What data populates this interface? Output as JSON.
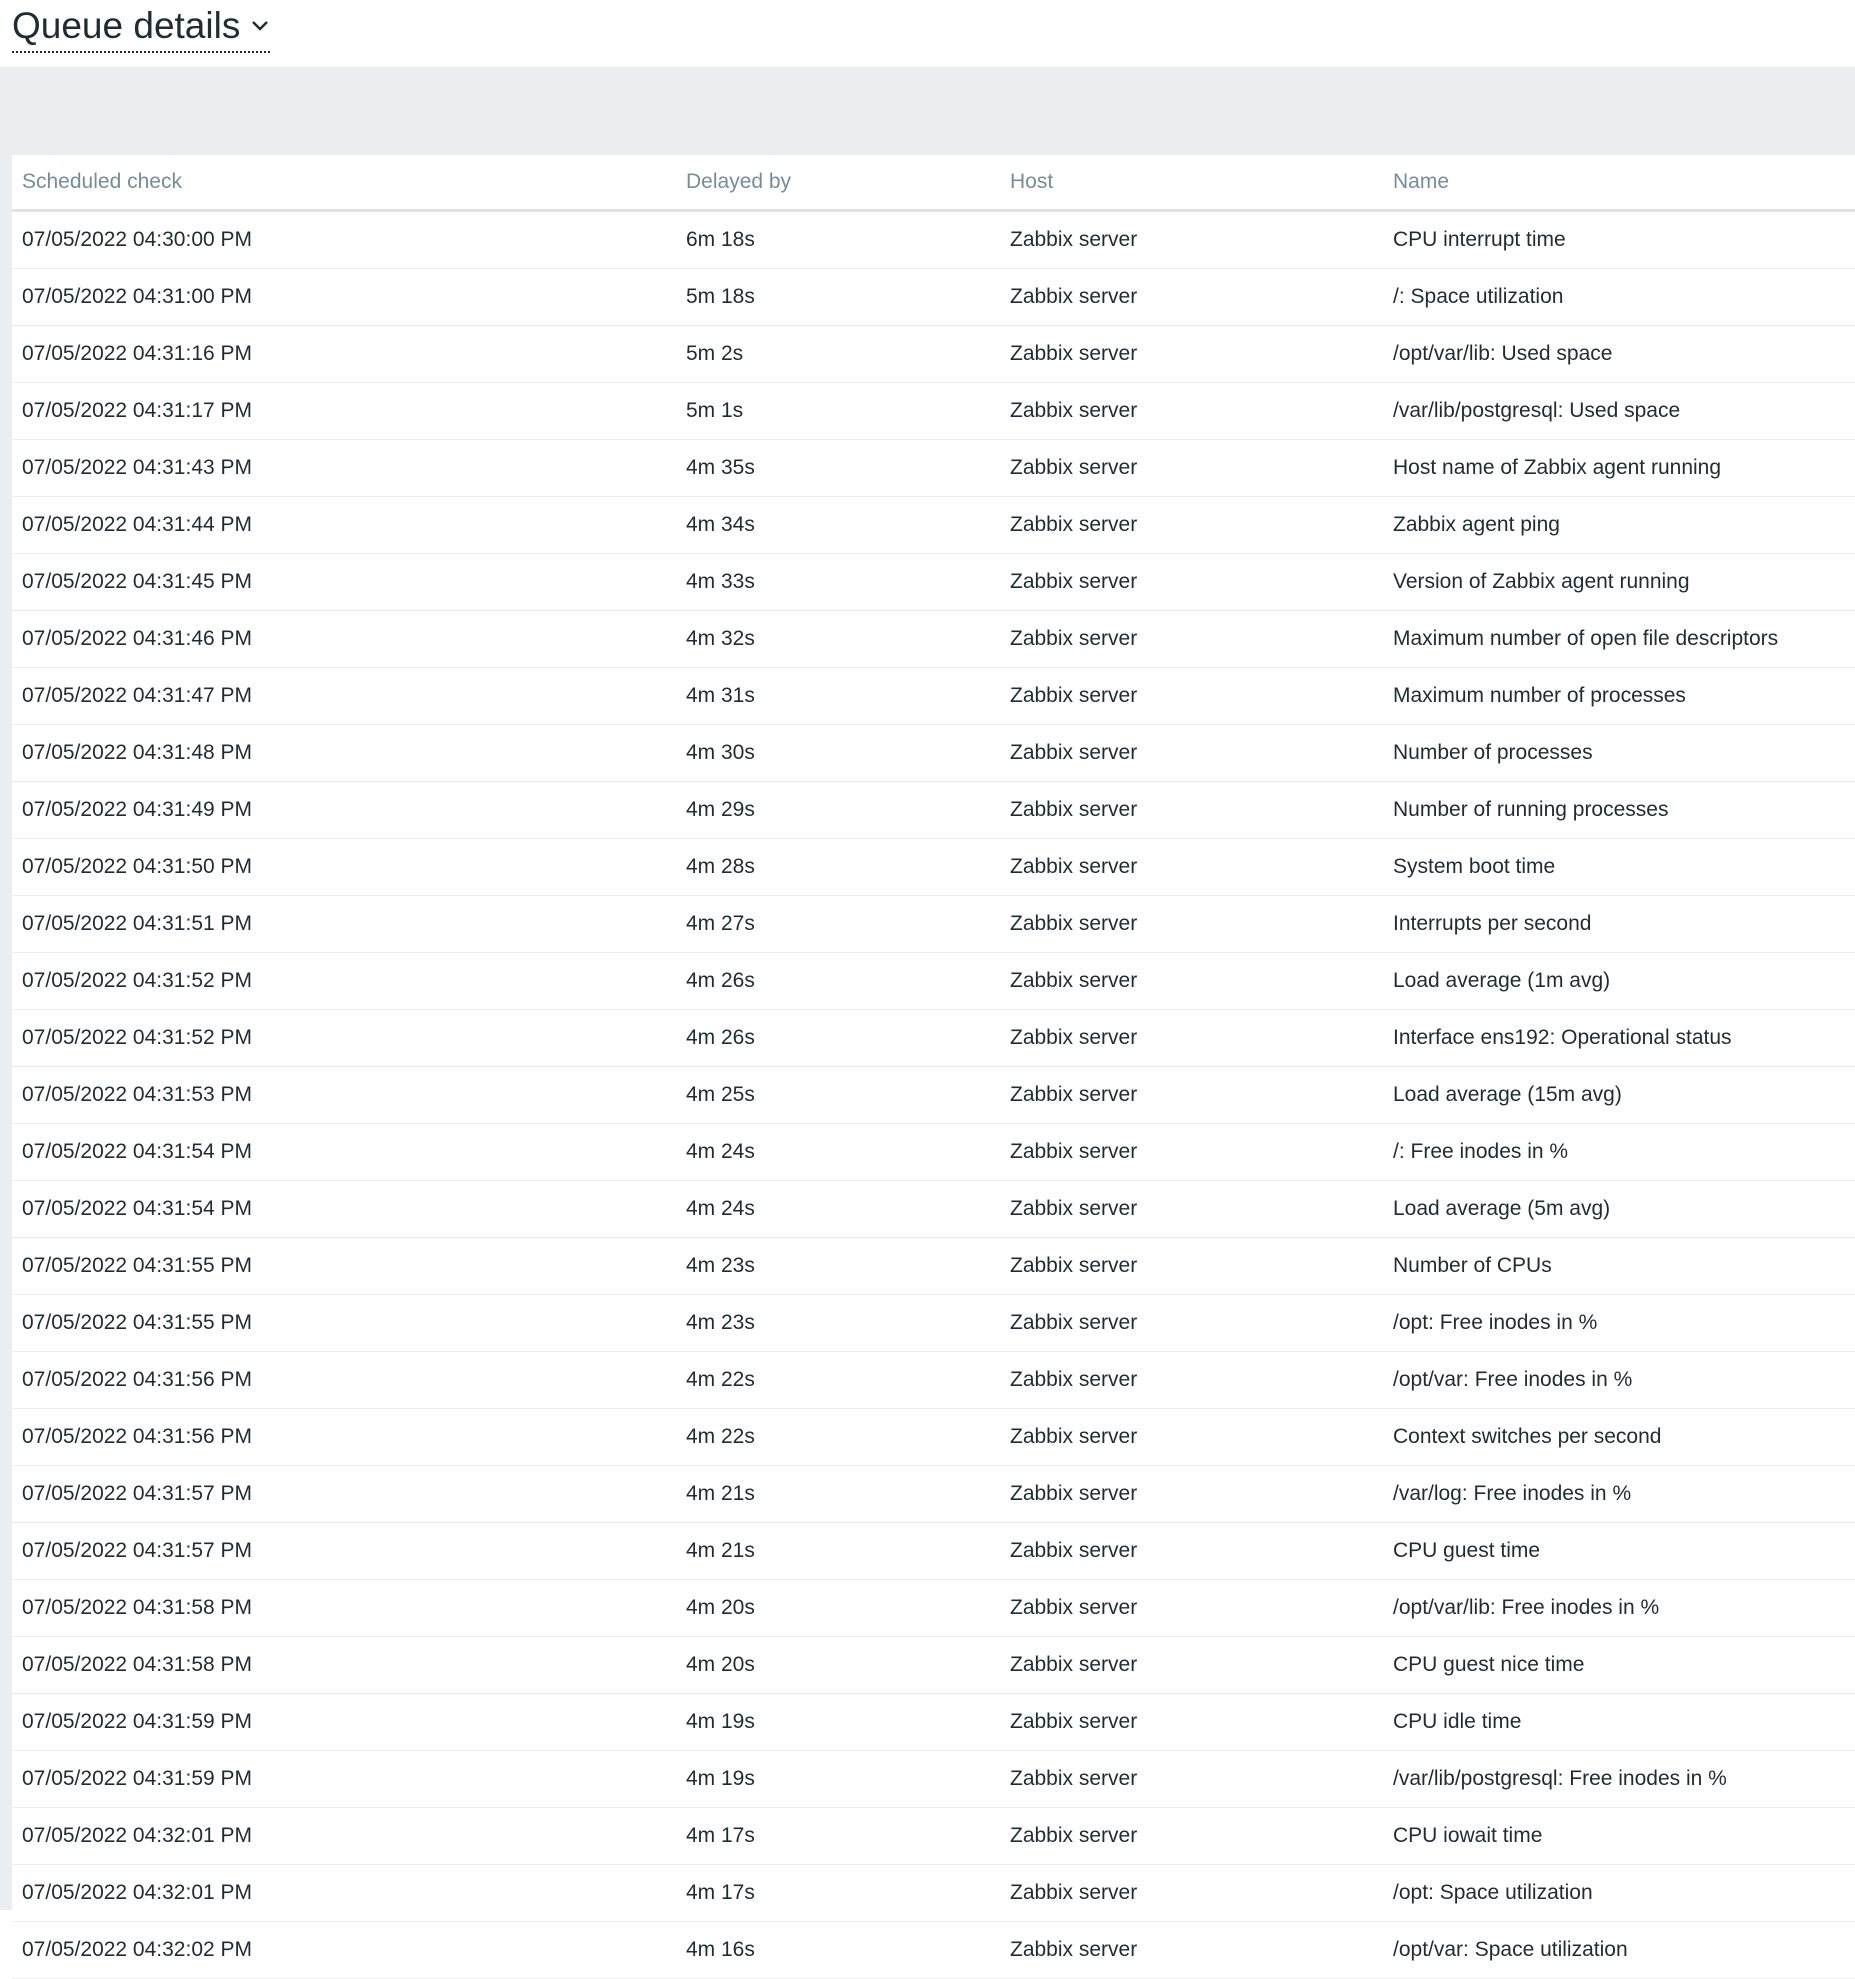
{
  "page": {
    "title": "Queue details"
  },
  "table": {
    "columns": [
      "Scheduled check",
      "Delayed by",
      "Host",
      "Name"
    ],
    "rows": [
      [
        "07/05/2022 04:30:00 PM",
        "6m 18s",
        "Zabbix server",
        "CPU interrupt time"
      ],
      [
        "07/05/2022 04:31:00 PM",
        "5m 18s",
        "Zabbix server",
        "/: Space utilization"
      ],
      [
        "07/05/2022 04:31:16 PM",
        "5m 2s",
        "Zabbix server",
        "/opt/var/lib: Used space"
      ],
      [
        "07/05/2022 04:31:17 PM",
        "5m 1s",
        "Zabbix server",
        "/var/lib/postgresql: Used space"
      ],
      [
        "07/05/2022 04:31:43 PM",
        "4m 35s",
        "Zabbix server",
        "Host name of Zabbix agent running"
      ],
      [
        "07/05/2022 04:31:44 PM",
        "4m 34s",
        "Zabbix server",
        "Zabbix agent ping"
      ],
      [
        "07/05/2022 04:31:45 PM",
        "4m 33s",
        "Zabbix server",
        "Version of Zabbix agent running"
      ],
      [
        "07/05/2022 04:31:46 PM",
        "4m 32s",
        "Zabbix server",
        "Maximum number of open file descriptors"
      ],
      [
        "07/05/2022 04:31:47 PM",
        "4m 31s",
        "Zabbix server",
        "Maximum number of processes"
      ],
      [
        "07/05/2022 04:31:48 PM",
        "4m 30s",
        "Zabbix server",
        "Number of processes"
      ],
      [
        "07/05/2022 04:31:49 PM",
        "4m 29s",
        "Zabbix server",
        "Number of running processes"
      ],
      [
        "07/05/2022 04:31:50 PM",
        "4m 28s",
        "Zabbix server",
        "System boot time"
      ],
      [
        "07/05/2022 04:31:51 PM",
        "4m 27s",
        "Zabbix server",
        "Interrupts per second"
      ],
      [
        "07/05/2022 04:31:52 PM",
        "4m 26s",
        "Zabbix server",
        "Load average (1m avg)"
      ],
      [
        "07/05/2022 04:31:52 PM",
        "4m 26s",
        "Zabbix server",
        "Interface ens192: Operational status"
      ],
      [
        "07/05/2022 04:31:53 PM",
        "4m 25s",
        "Zabbix server",
        "Load average (15m avg)"
      ],
      [
        "07/05/2022 04:31:54 PM",
        "4m 24s",
        "Zabbix server",
        "/: Free inodes in %"
      ],
      [
        "07/05/2022 04:31:54 PM",
        "4m 24s",
        "Zabbix server",
        "Load average (5m avg)"
      ],
      [
        "07/05/2022 04:31:55 PM",
        "4m 23s",
        "Zabbix server",
        "Number of CPUs"
      ],
      [
        "07/05/2022 04:31:55 PM",
        "4m 23s",
        "Zabbix server",
        "/opt: Free inodes in %"
      ],
      [
        "07/05/2022 04:31:56 PM",
        "4m 22s",
        "Zabbix server",
        "/opt/var: Free inodes in %"
      ],
      [
        "07/05/2022 04:31:56 PM",
        "4m 22s",
        "Zabbix server",
        "Context switches per second"
      ],
      [
        "07/05/2022 04:31:57 PM",
        "4m 21s",
        "Zabbix server",
        "/var/log: Free inodes in %"
      ],
      [
        "07/05/2022 04:31:57 PM",
        "4m 21s",
        "Zabbix server",
        "CPU guest time"
      ],
      [
        "07/05/2022 04:31:58 PM",
        "4m 20s",
        "Zabbix server",
        "/opt/var/lib: Free inodes in %"
      ],
      [
        "07/05/2022 04:31:58 PM",
        "4m 20s",
        "Zabbix server",
        "CPU guest nice time"
      ],
      [
        "07/05/2022 04:31:59 PM",
        "4m 19s",
        "Zabbix server",
        "CPU idle time"
      ],
      [
        "07/05/2022 04:31:59 PM",
        "4m 19s",
        "Zabbix server",
        "/var/lib/postgresql: Free inodes in %"
      ],
      [
        "07/05/2022 04:32:01 PM",
        "4m 17s",
        "Zabbix server",
        "CPU iowait time"
      ],
      [
        "07/05/2022 04:32:01 PM",
        "4m 17s",
        "Zabbix server",
        "/opt: Space utilization"
      ],
      [
        "07/05/2022 04:32:02 PM",
        "4m 16s",
        "Zabbix server",
        "/opt/var: Space utilization"
      ]
    ]
  }
}
